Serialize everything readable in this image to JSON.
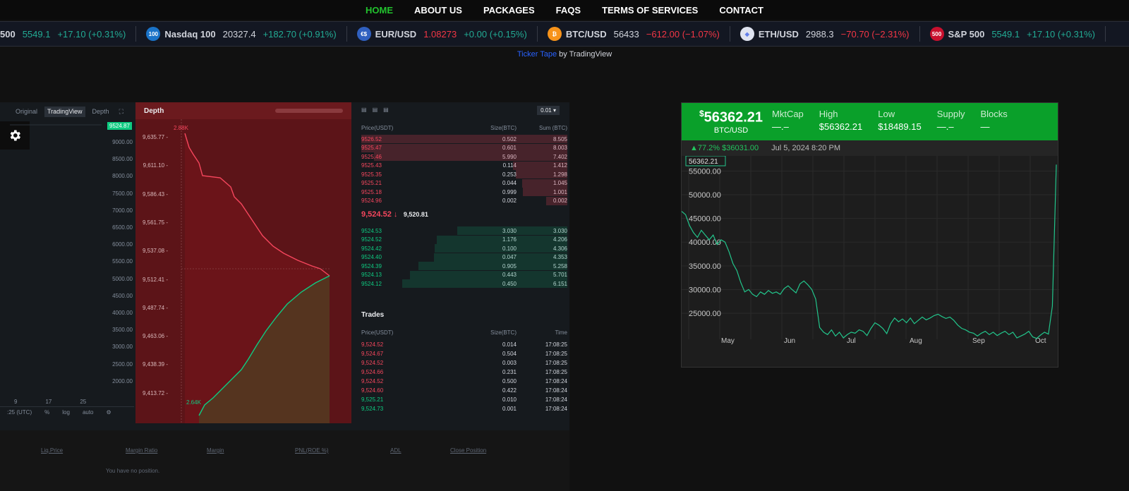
{
  "nav": [
    {
      "label": "HOME",
      "active": true
    },
    {
      "label": "ABOUT US"
    },
    {
      "label": "PACKAGES"
    },
    {
      "label": "FAQS"
    },
    {
      "label": "TERMS OF SERVICES"
    },
    {
      "label": "CONTACT"
    }
  ],
  "ticker": [
    {
      "name": "500",
      "price": "5549.1",
      "change": "+17.10 (+0.31%)",
      "dir": "up",
      "icon": ""
    },
    {
      "name": "Nasdaq 100",
      "price": "20327.4",
      "change": "+182.70 (+0.91%)",
      "dir": "up",
      "icon": "100",
      "color": "#1a73c8"
    },
    {
      "name": "EUR/USD",
      "price": "1.08273",
      "change": "+0.00 (+0.15%)",
      "dir": "up",
      "price_dir": "down",
      "icon": "€$",
      "color": "#3060c0"
    },
    {
      "name": "BTC/USD",
      "price": "56433",
      "change": "−612.00 (−1.07%)",
      "dir": "down",
      "icon": "₿",
      "color": "#f7931a"
    },
    {
      "name": "ETH/USD",
      "price": "2988.3",
      "change": "−70.70 (−2.31%)",
      "dir": "down",
      "icon": "◆",
      "color": "#dfe3f0"
    },
    {
      "name": "S&P 500",
      "price": "5549.1",
      "change": "+17.10 (+0.31%)",
      "dir": "up",
      "price_dir": "up",
      "icon": "500",
      "color": "#c8102e"
    }
  ],
  "credit": {
    "link": "Ticker Tape",
    "rest": " by TradingView"
  },
  "trade": {
    "chart_tabs": [
      "Original",
      "TradingView",
      "Depth"
    ],
    "price_tag": "9524.87",
    "y_ticks": [
      "9000.00",
      "8500.00",
      "8000.00",
      "7500.00",
      "7000.00",
      "6500.00",
      "6000.00",
      "5500.00",
      "5000.00",
      "4500.00",
      "4000.00",
      "3500.00",
      "3000.00",
      "2500.00",
      "2000.00"
    ],
    "x_ticks": [
      "9",
      "17",
      "25"
    ],
    "bottom": [
      ":25 (UTC)",
      "%",
      "log",
      "auto"
    ],
    "depth_title": "Depth",
    "depth_y": [
      "9,635.77 -",
      "9,611.10 -",
      "9,586.43 -",
      "9,561.75 -",
      "9,537.08 -",
      "9,512.41 -",
      "9,487.74 -",
      "9,463.06 -",
      "9,438.39 -",
      "9,413.72 -"
    ],
    "depth_top_label": "2.88K",
    "depth_bottom_label": "2.64K",
    "book_step": "0.01",
    "book_headers": [
      "Price(USDT)",
      "Size(BTC)",
      "Sum (BTC)"
    ],
    "asks": [
      [
        "9526.52",
        "0.502",
        "8.505"
      ],
      [
        "9525.47",
        "0.601",
        "8.003"
      ],
      [
        "9525.46",
        "5.990",
        "7.402"
      ],
      [
        "9525.43",
        "0.114",
        "1.412"
      ],
      [
        "9525.35",
        "0.253",
        "1.298"
      ],
      [
        "9525.21",
        "0.044",
        "1.045"
      ],
      [
        "9525.18",
        "0.999",
        "1.001"
      ],
      [
        "9524.96",
        "0.002",
        "0.002"
      ]
    ],
    "mid_price": "9,524.52",
    "mid_arrow": "↓",
    "mark_price": "9,520.81",
    "bids": [
      [
        "9524.53",
        "3.030",
        "3.030"
      ],
      [
        "9524.52",
        "1.176",
        "4.206"
      ],
      [
        "9524.42",
        "0.100",
        "4.306"
      ],
      [
        "9524.40",
        "0.047",
        "4.353"
      ],
      [
        "9524.39",
        "0.905",
        "5.258"
      ],
      [
        "9524.13",
        "0.443",
        "5.701"
      ],
      [
        "9524.12",
        "0.450",
        "6.151"
      ]
    ],
    "trades_title": "Trades",
    "trades_headers": [
      "Price(USDT)",
      "Size(BTC)",
      "Time"
    ],
    "trades": [
      [
        "9,524.52",
        "0.014",
        "17:08:25",
        "ask"
      ],
      [
        "9,524.67",
        "0.504",
        "17:08:25",
        "ask"
      ],
      [
        "9,524.52",
        "0.003",
        "17:08:25",
        "ask"
      ],
      [
        "9,524.66",
        "0.231",
        "17:08:25",
        "ask"
      ],
      [
        "9,524.52",
        "0.500",
        "17:08:24",
        "ask"
      ],
      [
        "9,524.60",
        "0.422",
        "17:08:24",
        "ask"
      ],
      [
        "9,525.21",
        "0.010",
        "17:08:24",
        "bid"
      ],
      [
        "9,524.73",
        "0.001",
        "17:08:24",
        "bid"
      ]
    ],
    "position_cols": [
      "Liq.Price",
      "Margin Ratio",
      "Margin",
      "PNL(ROE %)",
      "ADL",
      "Close Position"
    ],
    "position_empty": "You have no position."
  },
  "widget": {
    "price": "56362.21",
    "currency_sign": "$",
    "pair": "BTC/USD",
    "stats": [
      {
        "label": "MktCap",
        "value": "—.–"
      },
      {
        "label": "High",
        "value": "$56362.21"
      },
      {
        "label": "Low",
        "value": "$18489.15"
      },
      {
        "label": "Supply",
        "value": "—.–"
      },
      {
        "label": "Blocks",
        "value": "—"
      }
    ],
    "change": "▲77.2%",
    "change_abs": "$36031.00",
    "timestamp": "Jul 5, 2024 8:20 PM",
    "last_tag": "56362.21"
  },
  "chart_data": {
    "type": "line",
    "x_ticks": [
      "May",
      "Jun",
      "Jul",
      "Aug",
      "Sep",
      "Oct"
    ],
    "y_ticks": [
      "55000.00",
      "50000.00",
      "45000.00",
      "40000.00",
      "35000.00",
      "30000.00",
      "25000.00"
    ],
    "ylim": [
      19500,
      57000
    ],
    "values": [
      46500,
      45800,
      43500,
      42000,
      41000,
      42500,
      41500,
      40500,
      41500,
      39500,
      40500,
      40000,
      38000,
      35500,
      34000,
      31500,
      29500,
      30000,
      29000,
      28500,
      29500,
      29000,
      29800,
      29200,
      29500,
      29000,
      30200,
      30800,
      30000,
      29300,
      31200,
      31800,
      31000,
      30000,
      28000,
      22000,
      21000,
      20500,
      21500,
      20200,
      21000,
      19800,
      20500,
      21000,
      20800,
      21500,
      21200,
      20300,
      21800,
      23000,
      22500,
      21800,
      20700,
      22800,
      24000,
      23200,
      23800,
      23000,
      24000,
      22800,
      23500,
      24200,
      23600,
      24000,
      24500,
      24800,
      24300,
      23900,
      24200,
      23500,
      22500,
      21800,
      21500,
      21000,
      20800,
      20200,
      20800,
      21200,
      20500,
      21000,
      20300,
      20800,
      21200,
      20500,
      21000,
      19800,
      20200,
      20600,
      21200,
      20000,
      19700,
      20400,
      21000,
      20600,
      26500,
      56362
    ]
  }
}
